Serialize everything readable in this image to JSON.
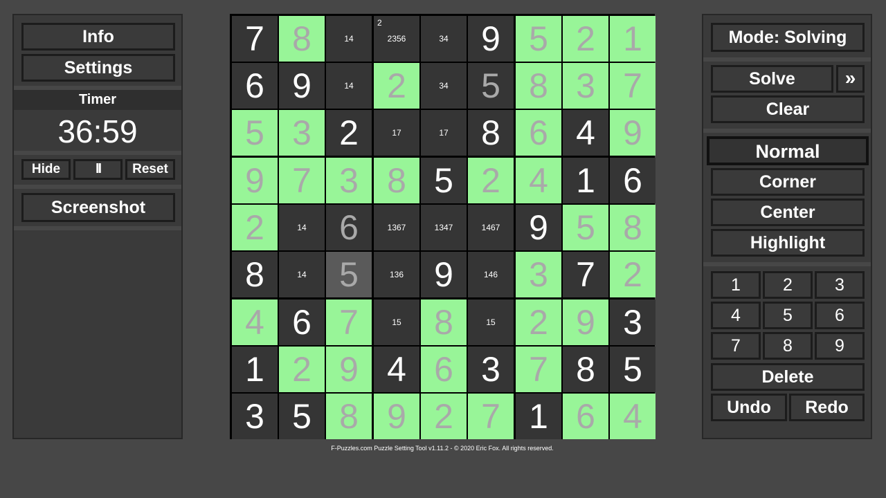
{
  "left_panel": {
    "info_label": "Info",
    "settings_label": "Settings",
    "timer_title": "Timer",
    "timer_value": "36:59",
    "hide_label": "Hide",
    "pause_label": "II",
    "reset_label": "Reset",
    "screenshot_label": "Screenshot"
  },
  "right_panel": {
    "mode_label": "Mode: Solving",
    "solve_label": "Solve",
    "next_label": "»",
    "clear_label": "Clear",
    "normal_label": "Normal",
    "corner_label": "Corner",
    "center_label": "Center",
    "highlight_label": "Highlight",
    "digits": [
      "1",
      "2",
      "3",
      "4",
      "5",
      "6",
      "7",
      "8",
      "9"
    ],
    "delete_label": "Delete",
    "undo_label": "Undo",
    "redo_label": "Redo"
  },
  "footer_text": "F-Puzzles.com Puzzle Setting Tool v1.11.2 - © 2020 Eric Fox. All rights reserved.",
  "colors": {
    "highlight_green": "#98f598",
    "selected_cell": "#5a5a5a",
    "cell_dark": "#353535",
    "given_digit": "#ffffff",
    "entered_digit": "#a9a9a9"
  },
  "board": {
    "cells": [
      [
        {
          "v": "7",
          "t": "given"
        },
        {
          "v": "8",
          "t": "entered",
          "h": true
        },
        {
          "c": "14"
        },
        {
          "c": "2356",
          "k": "2"
        },
        {
          "c": "34"
        },
        {
          "v": "9",
          "t": "given"
        },
        {
          "v": "5",
          "t": "entered",
          "h": true
        },
        {
          "v": "2",
          "t": "entered",
          "h": true
        },
        {
          "v": "1",
          "t": "entered",
          "h": true
        }
      ],
      [
        {
          "v": "6",
          "t": "given"
        },
        {
          "v": "9",
          "t": "given"
        },
        {
          "c": "14"
        },
        {
          "v": "2",
          "t": "entered",
          "h": true
        },
        {
          "c": "34"
        },
        {
          "v": "5",
          "t": "entered"
        },
        {
          "v": "8",
          "t": "entered",
          "h": true
        },
        {
          "v": "3",
          "t": "entered",
          "h": true
        },
        {
          "v": "7",
          "t": "entered",
          "h": true
        }
      ],
      [
        {
          "v": "5",
          "t": "entered",
          "h": true
        },
        {
          "v": "3",
          "t": "entered",
          "h": true
        },
        {
          "v": "2",
          "t": "given"
        },
        {
          "c": "17"
        },
        {
          "c": "17"
        },
        {
          "v": "8",
          "t": "given"
        },
        {
          "v": "6",
          "t": "entered",
          "h": true
        },
        {
          "v": "4",
          "t": "given"
        },
        {
          "v": "9",
          "t": "entered",
          "h": true
        }
      ],
      [
        {
          "v": "9",
          "t": "entered",
          "h": true
        },
        {
          "v": "7",
          "t": "entered",
          "h": true
        },
        {
          "v": "3",
          "t": "entered",
          "h": true
        },
        {
          "v": "8",
          "t": "entered",
          "h": true
        },
        {
          "v": "5",
          "t": "given"
        },
        {
          "v": "2",
          "t": "entered",
          "h": true
        },
        {
          "v": "4",
          "t": "entered",
          "h": true
        },
        {
          "v": "1",
          "t": "given"
        },
        {
          "v": "6",
          "t": "given"
        }
      ],
      [
        {
          "v": "2",
          "t": "entered",
          "h": true
        },
        {
          "c": "14"
        },
        {
          "v": "6",
          "t": "entered"
        },
        {
          "c": "1367"
        },
        {
          "c": "1347"
        },
        {
          "c": "1467"
        },
        {
          "v": "9",
          "t": "given"
        },
        {
          "v": "5",
          "t": "entered",
          "h": true
        },
        {
          "v": "8",
          "t": "entered",
          "h": true
        }
      ],
      [
        {
          "v": "8",
          "t": "given"
        },
        {
          "c": "14"
        },
        {
          "v": "5",
          "t": "entered",
          "s": true
        },
        {
          "c": "136"
        },
        {
          "v": "9",
          "t": "given"
        },
        {
          "c": "146"
        },
        {
          "v": "3",
          "t": "entered",
          "h": true
        },
        {
          "v": "7",
          "t": "given"
        },
        {
          "v": "2",
          "t": "entered",
          "h": true
        }
      ],
      [
        {
          "v": "4",
          "t": "entered",
          "h": true
        },
        {
          "v": "6",
          "t": "given"
        },
        {
          "v": "7",
          "t": "entered",
          "h": true
        },
        {
          "c": "15"
        },
        {
          "v": "8",
          "t": "entered",
          "h": true
        },
        {
          "c": "15"
        },
        {
          "v": "2",
          "t": "entered",
          "h": true
        },
        {
          "v": "9",
          "t": "entered",
          "h": true
        },
        {
          "v": "3",
          "t": "given"
        }
      ],
      [
        {
          "v": "1",
          "t": "given"
        },
        {
          "v": "2",
          "t": "entered",
          "h": true
        },
        {
          "v": "9",
          "t": "entered",
          "h": true
        },
        {
          "v": "4",
          "t": "given"
        },
        {
          "v": "6",
          "t": "entered",
          "h": true
        },
        {
          "v": "3",
          "t": "given"
        },
        {
          "v": "7",
          "t": "entered",
          "h": true
        },
        {
          "v": "8",
          "t": "given"
        },
        {
          "v": "5",
          "t": "given"
        }
      ],
      [
        {
          "v": "3",
          "t": "given"
        },
        {
          "v": "5",
          "t": "given"
        },
        {
          "v": "8",
          "t": "entered",
          "h": true
        },
        {
          "v": "9",
          "t": "entered",
          "h": true
        },
        {
          "v": "2",
          "t": "entered",
          "h": true
        },
        {
          "v": "7",
          "t": "entered",
          "h": true
        },
        {
          "v": "1",
          "t": "given"
        },
        {
          "v": "6",
          "t": "entered",
          "h": true
        },
        {
          "v": "4",
          "t": "entered",
          "h": true
        }
      ]
    ]
  }
}
